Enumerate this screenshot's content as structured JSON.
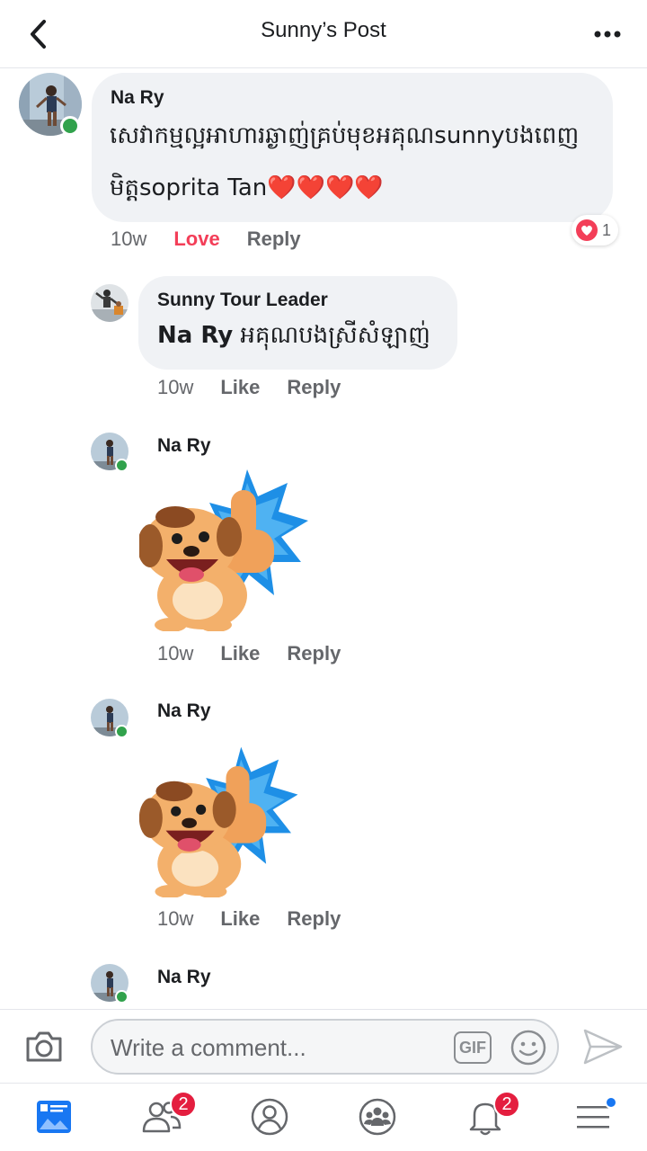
{
  "header": {
    "title": "Sunny’s Post"
  },
  "comments": [
    {
      "author": "Na Ry",
      "text_line1": "សេវាកម្មល្អអាហារឆ្ងាញ់គ្រប់មុខអគុណsunnyបងពេញ",
      "text_line2": "មិត្តsoprita Tan",
      "hearts": "❤️❤️❤️❤️",
      "time": "10w",
      "love_label": "Love",
      "reply_label": "Reply",
      "reaction_count": "1"
    },
    {
      "author": "Sunny Tour Leader",
      "mention": "Na Ry",
      "text": " អគុណបងស្រីសំឡាញ់",
      "time": "10w",
      "like_label": "Like",
      "reply_label": "Reply"
    },
    {
      "author": "Na Ry",
      "sticker": "dog-thumbs-up-sticker",
      "time": "10w",
      "like_label": "Like",
      "reply_label": "Reply"
    },
    {
      "author": "Na Ry",
      "sticker": "dog-thumbs-up-sticker",
      "time": "10w",
      "like_label": "Like",
      "reply_label": "Reply"
    },
    {
      "author": "Na Ry"
    }
  ],
  "composer": {
    "placeholder": "Write a comment...",
    "gif_label": "GIF"
  },
  "bottom_nav": {
    "friends_badge": "2",
    "notifications_badge": "2"
  },
  "colors": {
    "brand_blue": "#1877f2",
    "love_red": "#f33e58",
    "online_green": "#31a24c",
    "badge_red": "#e41e3f",
    "bubble_gray": "#f0f2f5"
  }
}
